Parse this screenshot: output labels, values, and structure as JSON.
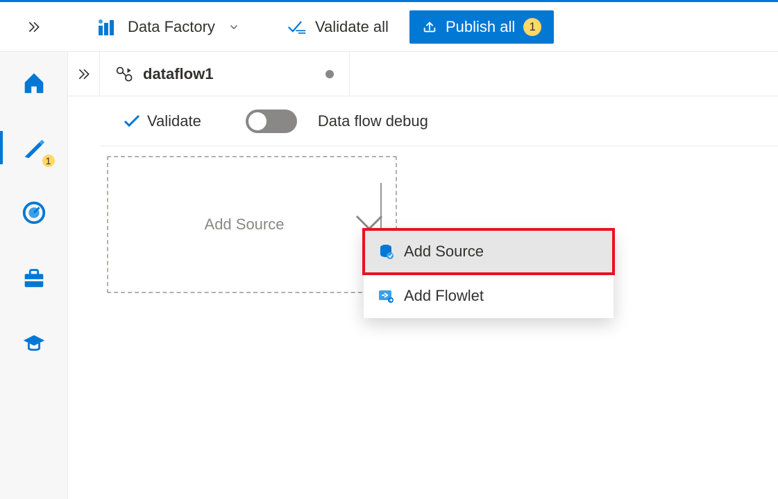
{
  "header": {
    "brand": "Data Factory",
    "validate_all": "Validate all",
    "publish_all": "Publish all",
    "publish_count": "1"
  },
  "left_rail": {
    "author_pending": "1"
  },
  "tab": {
    "title": "dataflow1"
  },
  "toolbar": {
    "validate": "Validate",
    "debug_label": "Data flow debug"
  },
  "canvas": {
    "add_source_placeholder": "Add Source"
  },
  "menu": {
    "add_source": "Add Source",
    "add_flowlet": "Add Flowlet"
  }
}
